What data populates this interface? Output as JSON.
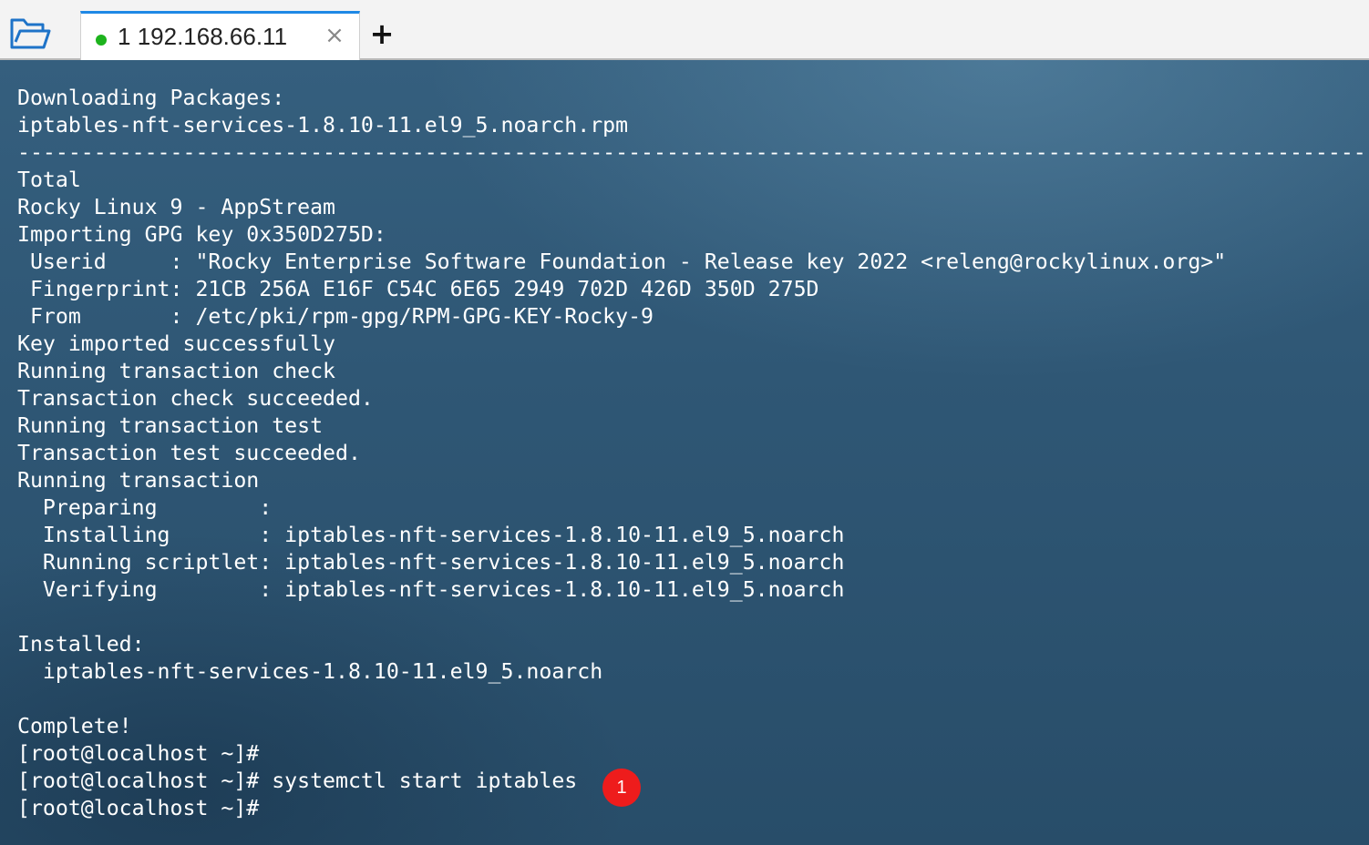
{
  "toolbar": {
    "folder_icon": "folder-open-icon",
    "new_tab_label": "+"
  },
  "tab": {
    "number": "1",
    "host": "192.168.66.11",
    "status_color": "#1db31d",
    "close_label": "×"
  },
  "terminal": {
    "lines": [
      "Downloading Packages:",
      "iptables-nft-services-1.8.10-11.el9_5.noarch.rpm",
      "--------------------------------------------------------------------------------------------------------------------------",
      "Total",
      "Rocky Linux 9 - AppStream",
      "Importing GPG key 0x350D275D:",
      " Userid     : \"Rocky Enterprise Software Foundation - Release key 2022 <releng@rockylinux.org>\"",
      " Fingerprint: 21CB 256A E16F C54C 6E65 2949 702D 426D 350D 275D",
      " From       : /etc/pki/rpm-gpg/RPM-GPG-KEY-Rocky-9",
      "Key imported successfully",
      "Running transaction check",
      "Transaction check succeeded.",
      "Running transaction test",
      "Transaction test succeeded.",
      "Running transaction",
      "  Preparing        :",
      "  Installing       : iptables-nft-services-1.8.10-11.el9_5.noarch",
      "  Running scriptlet: iptables-nft-services-1.8.10-11.el9_5.noarch",
      "  Verifying        : iptables-nft-services-1.8.10-11.el9_5.noarch",
      "",
      "Installed:",
      "  iptables-nft-services-1.8.10-11.el9_5.noarch",
      "",
      "Complete!",
      "[root@localhost ~]#",
      "[root@localhost ~]# systemctl start iptables",
      "[root@localhost ~]#"
    ]
  },
  "annotation": {
    "badge_label": "1",
    "badge_color": "#ee1c1c"
  }
}
